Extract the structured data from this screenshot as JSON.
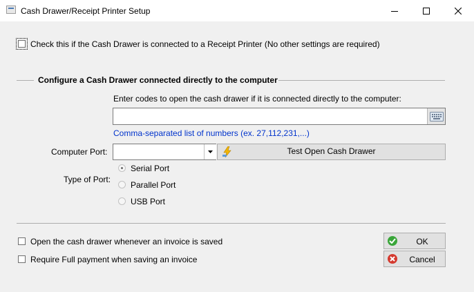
{
  "window": {
    "title": "Cash Drawer/Receipt Printer Setup",
    "icon": "cash-register-icon"
  },
  "receipt_printer": {
    "label": "Check this if the Cash Drawer is connected to a Receipt Printer (No other settings are required)",
    "checked": false
  },
  "group": {
    "title": "Configure a Cash Drawer connected directly to the computer",
    "codes_label": "Enter codes to open the cash drawer if it is connected directly to the computer:",
    "codes_value": "",
    "hint": "Comma-separated list of numbers (ex. 27,112,231,...)",
    "port_label": "Computer Port:",
    "port_value": "",
    "test_button": "Test Open Cash Drawer",
    "port_type_label": "Type of Port:",
    "port_types": [
      {
        "label": "Serial Port",
        "selected": true
      },
      {
        "label": "Parallel Port",
        "selected": false
      },
      {
        "label": "USB Port",
        "selected": false
      }
    ]
  },
  "options": [
    {
      "label": "Open the cash drawer whenever an invoice is saved",
      "checked": false
    },
    {
      "label": "Require Full payment when saving an invoice",
      "checked": false
    }
  ],
  "buttons": {
    "ok": "OK",
    "cancel": "Cancel"
  },
  "colors": {
    "hint": "#0033cc",
    "ok_icon": "#3aa63a",
    "cancel_icon": "#d43a2f"
  }
}
